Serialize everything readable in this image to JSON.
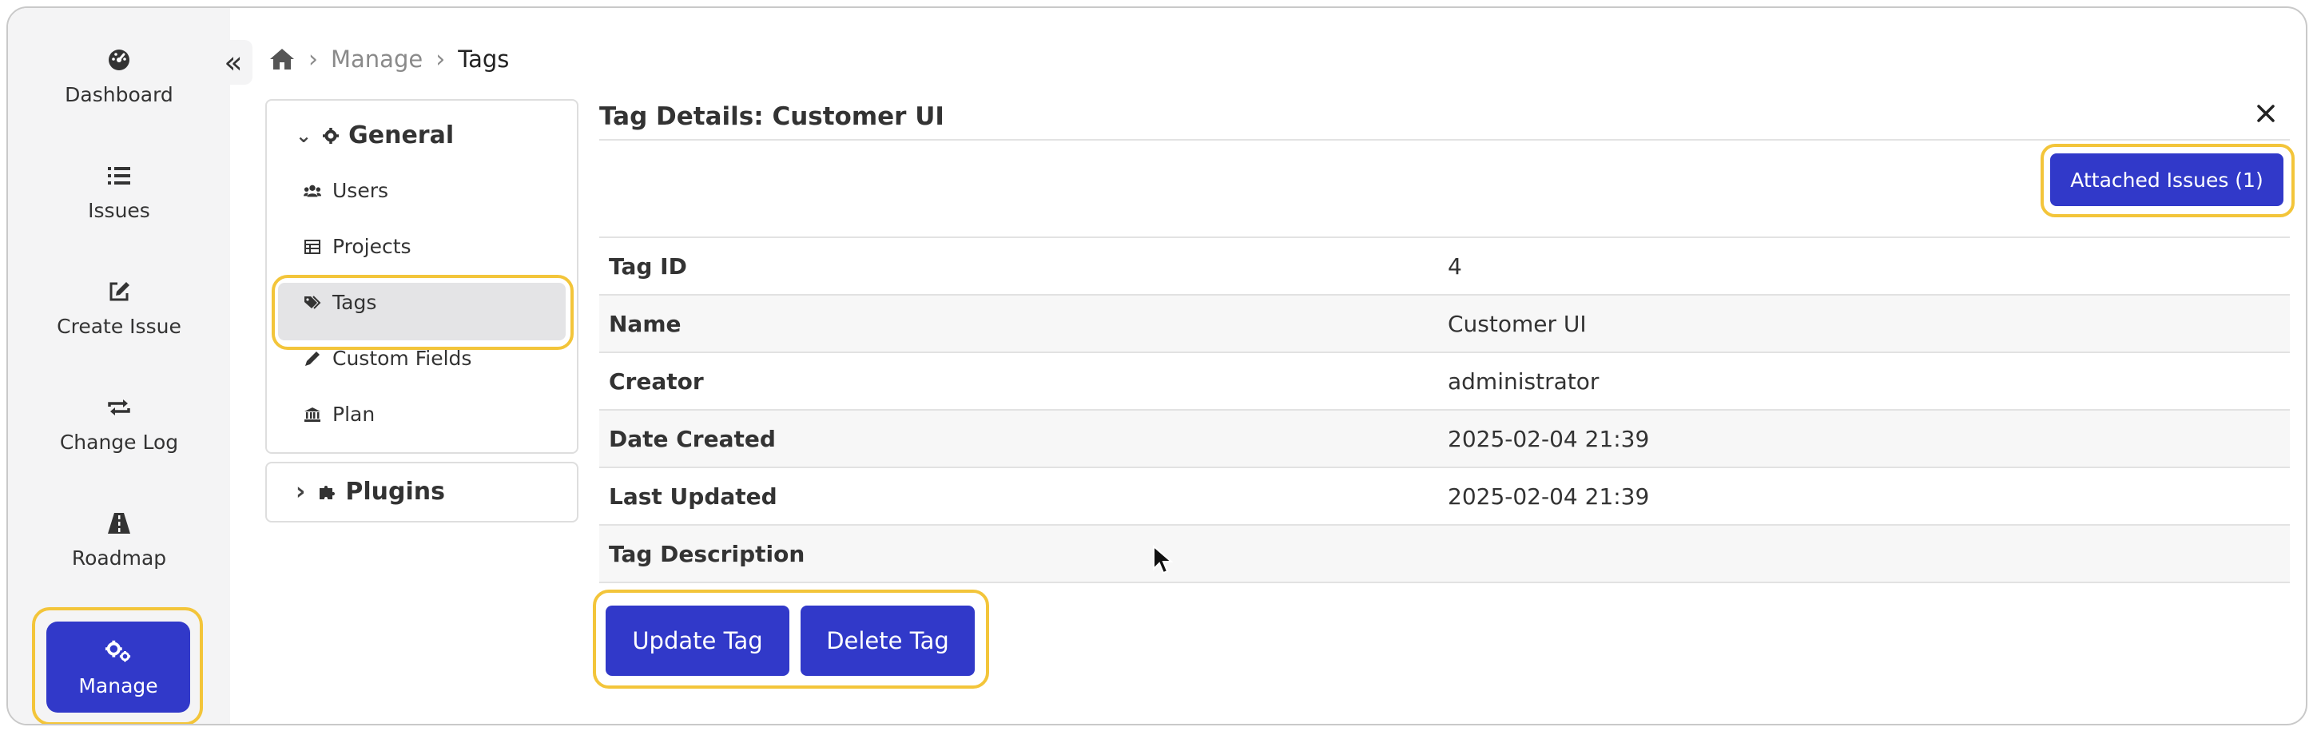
{
  "nav": {
    "items": [
      {
        "label": "Dashboard",
        "icon": "dashboard-icon"
      },
      {
        "label": "Issues",
        "icon": "list-icon"
      },
      {
        "label": "Create Issue",
        "icon": "edit-icon"
      },
      {
        "label": "Change Log",
        "icon": "repeat-icon"
      },
      {
        "label": "Roadmap",
        "icon": "road-icon"
      },
      {
        "label": "Manage",
        "icon": "cogs-icon"
      }
    ]
  },
  "breadcrumb": {
    "home_icon": "home-icon",
    "manage": "Manage",
    "current": "Tags"
  },
  "settings": {
    "general_label": "General",
    "items": [
      {
        "label": "Users",
        "icon": "users-icon"
      },
      {
        "label": "Projects",
        "icon": "table-icon"
      },
      {
        "label": "Tags",
        "icon": "tags-icon"
      },
      {
        "label": "Custom Fields",
        "icon": "pencil-icon"
      },
      {
        "label": "Plan",
        "icon": "bank-icon"
      }
    ],
    "plugins_label": "Plugins"
  },
  "details": {
    "title": "Tag Details: Customer UI",
    "attached_issues_label": "Attached Issues (1)",
    "rows": [
      {
        "key": "Tag ID",
        "value": "4"
      },
      {
        "key": "Name",
        "value": "Customer UI"
      },
      {
        "key": "Creator",
        "value": "administrator"
      },
      {
        "key": "Date Created",
        "value": "2025-02-04 21:39"
      },
      {
        "key": "Last Updated",
        "value": "2025-02-04 21:39"
      },
      {
        "key": "Tag Description",
        "value": ""
      }
    ],
    "update_label": "Update Tag",
    "delete_label": "Delete Tag"
  },
  "colors": {
    "accent": "#3139c9",
    "highlight": "#f3c53a"
  }
}
